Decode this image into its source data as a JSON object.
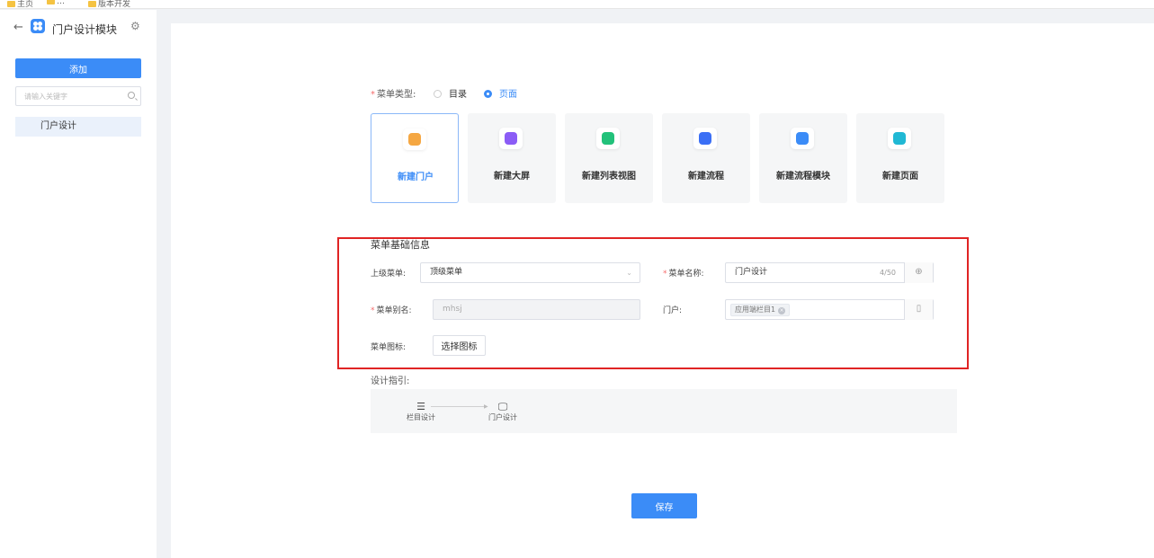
{
  "bookmarks": [
    "主页",
    "…",
    "版本开发"
  ],
  "app": {
    "back": "←",
    "title": "门户设计模块",
    "settings_glyph": "⚙"
  },
  "sidebar": {
    "add_label": "添加",
    "search_placeholder": "请输入关键字",
    "items": [
      {
        "label": "门户设计"
      }
    ]
  },
  "menu_type": {
    "label": "菜单类型:",
    "options": [
      {
        "label": "目录",
        "selected": false
      },
      {
        "label": "页面",
        "selected": true
      }
    ]
  },
  "cards": [
    {
      "label": "新建门户",
      "icon": "portal-icon",
      "color": "#f5a742",
      "active": true
    },
    {
      "label": "新建大屏",
      "icon": "screen-icon",
      "color": "#8b5cf6",
      "active": false
    },
    {
      "label": "新建列表视图",
      "icon": "list-view-icon",
      "color": "#22c17a",
      "active": false
    },
    {
      "label": "新建流程",
      "icon": "flow-icon",
      "color": "#3b6ff5",
      "active": false
    },
    {
      "label": "新建流程模块",
      "icon": "flow-module-icon",
      "color": "#3b8cf7",
      "active": false
    },
    {
      "label": "新建页面",
      "icon": "page-icon",
      "color": "#20b8d4",
      "active": false
    }
  ],
  "basic_info": {
    "title": "菜单基础信息",
    "parent_menu": {
      "label": "上级菜单:",
      "value": "顶级菜单"
    },
    "menu_name": {
      "label": "菜单名称:",
      "value": "门户设计",
      "counter": "4/50"
    },
    "menu_alias": {
      "label": "菜单别名:",
      "value": "mhsj"
    },
    "portal": {
      "label": "门户:",
      "tag": "应用端栏目1"
    },
    "menu_icon": {
      "label": "菜单图标:",
      "button": "选择图标"
    }
  },
  "guide": {
    "label": "设计指引:",
    "steps": [
      {
        "label": "栏目设计",
        "icon": "column-design-icon"
      },
      {
        "label": "门户设计",
        "icon": "monitor-icon"
      }
    ]
  },
  "save_label": "保存",
  "colors": {
    "primary": "#3b8cf7",
    "highlight_box": "#e02424",
    "required": "#f56c6c"
  }
}
